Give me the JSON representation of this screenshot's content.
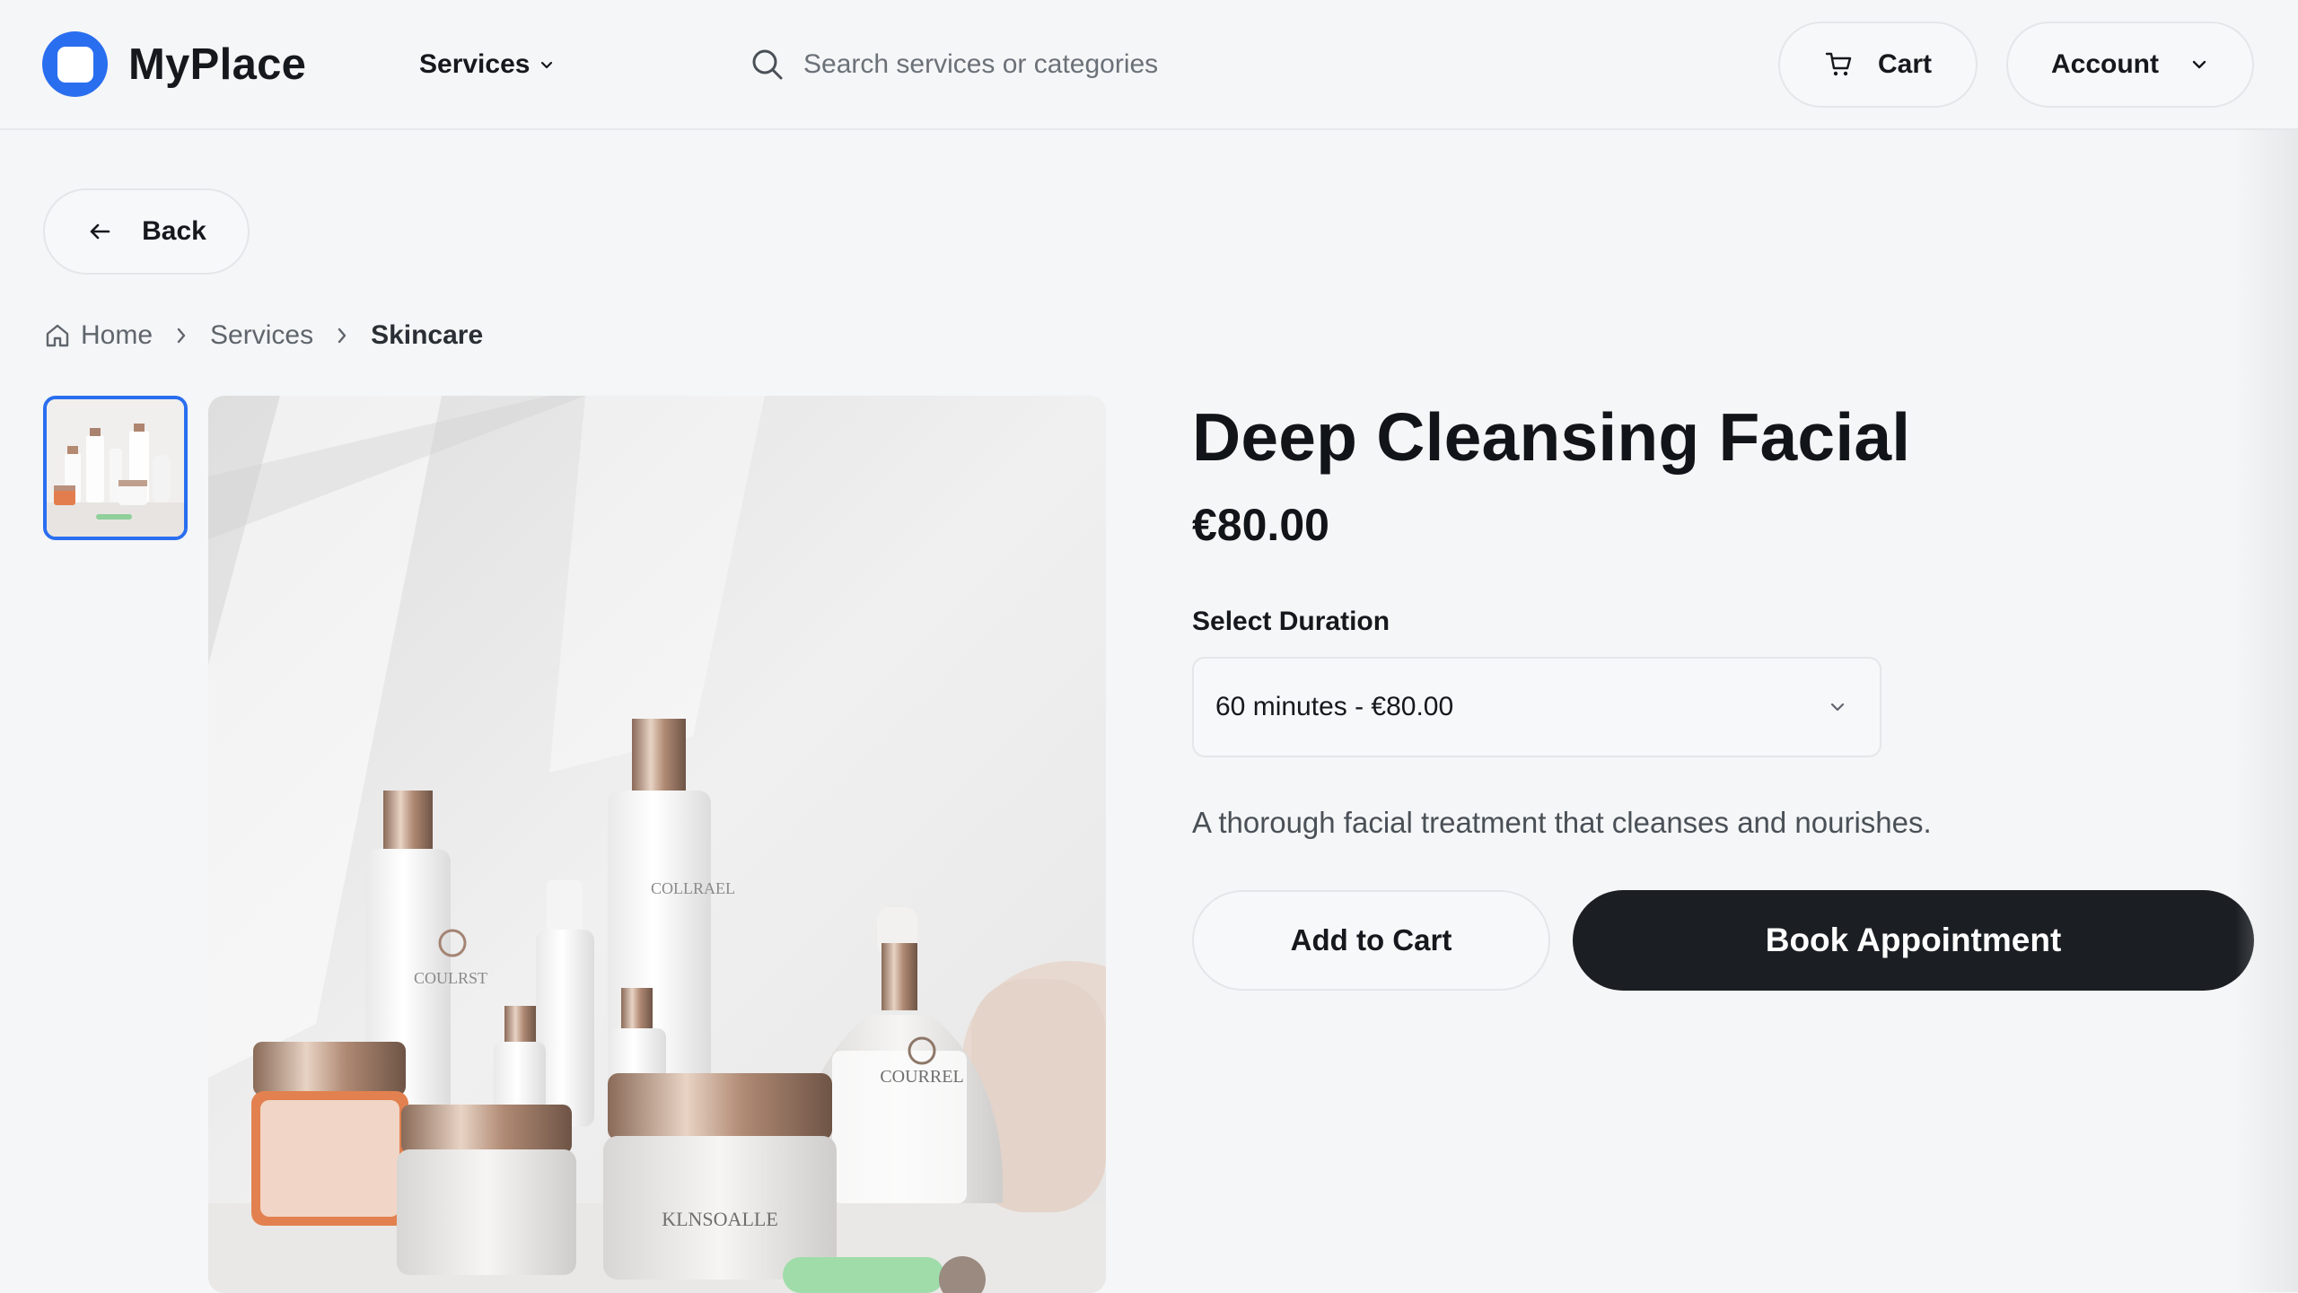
{
  "header": {
    "brand": "MyPlace",
    "nav": {
      "services_label": "Services"
    },
    "search": {
      "placeholder": "Search services or categories"
    },
    "cart_label": "Cart",
    "account_label": "Account"
  },
  "back_label": "Back",
  "breadcrumb": [
    "Home",
    "Services",
    "Skincare"
  ],
  "product": {
    "title": "Deep Cleansing Facial",
    "price": "€80.00",
    "duration_label": "Select Duration",
    "duration_selected": "60 minutes - €80.00",
    "description": "A thorough facial treatment that cleanses and nourishes.",
    "add_to_cart_label": "Add to Cart",
    "book_label": "Book Appointment",
    "image_product_labels": [
      "COULRST",
      "COLLRAEL",
      "COURREL",
      "KLNSOALLE"
    ]
  },
  "colors": {
    "brand": "#2a6ef0",
    "primary_button": "#1b1f23",
    "page_background": "#f5f6f7"
  }
}
